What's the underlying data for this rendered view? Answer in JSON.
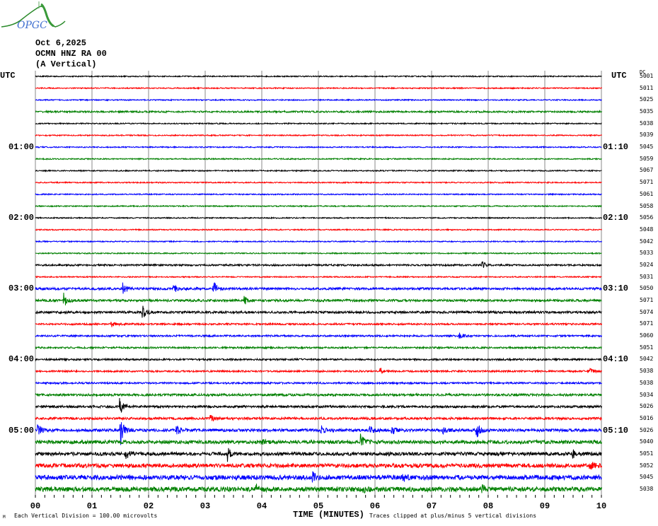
{
  "header": {
    "date": "Oct 6,2025",
    "station": "OCMN HNZ RA 00",
    "component": "(A Vertical)",
    "logo_text": "OPGC"
  },
  "left_axis_label": "UTC",
  "right_axis_label": "UTC",
  "dc_label": "DC",
  "footer": {
    "mark": "M",
    "scale_note": "Each Vertical Division =  100.00 microvolts",
    "xlabel": "TIME (MINUTES)",
    "clip_note": "Traces clipped at plus/minus 5 vertical divisions"
  },
  "chart_data": {
    "type": "line",
    "title": "OCMN HNZ RA 00 helicorder, Oct 6,2025",
    "xlabel": "TIME (MINUTES)",
    "ylabel": "UTC",
    "xlim": [
      0,
      10
    ],
    "x_ticks": [
      "00",
      "01",
      "02",
      "03",
      "04",
      "05",
      "06",
      "07",
      "08",
      "09",
      "10"
    ],
    "grid": true,
    "colors": [
      "#000000",
      "#ff0000",
      "#0000ff",
      "#008000"
    ],
    "minutes_per_row": 10,
    "left_time_labels": [
      {
        "row": 6,
        "text": "01:00"
      },
      {
        "row": 12,
        "text": "02:00"
      },
      {
        "row": 18,
        "text": "03:00"
      },
      {
        "row": 24,
        "text": "04:00"
      },
      {
        "row": 30,
        "text": "05:00"
      }
    ],
    "right_time_labels": [
      {
        "row": 6,
        "text": "01:10"
      },
      {
        "row": 12,
        "text": "02:10"
      },
      {
        "row": 18,
        "text": "03:10"
      },
      {
        "row": 24,
        "text": "04:10"
      },
      {
        "row": 30,
        "text": "05:10"
      }
    ],
    "dc_values": [
      5001,
      5011,
      5025,
      5035,
      5038,
      5039,
      5045,
      5059,
      5067,
      5071,
      5061,
      5058,
      5056,
      5048,
      5042,
      5033,
      5024,
      5031,
      5050,
      5071,
      5074,
      5071,
      5060,
      5051,
      5042,
      5038,
      5038,
      5034,
      5026,
      5016,
      5026,
      5040,
      5051,
      5052,
      5045,
      5038
    ],
    "noise_level_divisions": [
      0.1,
      0.1,
      0.1,
      0.15,
      0.1,
      0.1,
      0.1,
      0.1,
      0.1,
      0.1,
      0.1,
      0.1,
      0.1,
      0.1,
      0.1,
      0.1,
      0.15,
      0.1,
      0.2,
      0.2,
      0.2,
      0.15,
      0.15,
      0.15,
      0.15,
      0.15,
      0.15,
      0.2,
      0.2,
      0.2,
      0.25,
      0.3,
      0.3,
      0.35,
      0.4,
      0.4
    ],
    "events": [
      {
        "row": 16,
        "minute": 7.9,
        "amp": 0.5
      },
      {
        "row": 18,
        "minute": 1.55,
        "amp": 1.0
      },
      {
        "row": 18,
        "minute": 2.45,
        "amp": 0.6
      },
      {
        "row": 18,
        "minute": 3.15,
        "amp": 1.2
      },
      {
        "row": 19,
        "minute": 0.5,
        "amp": 1.2
      },
      {
        "row": 19,
        "minute": 3.7,
        "amp": 0.6
      },
      {
        "row": 20,
        "minute": 1.9,
        "amp": 1.0
      },
      {
        "row": 21,
        "minute": 1.35,
        "amp": 0.8
      },
      {
        "row": 22,
        "minute": 7.5,
        "amp": 0.5
      },
      {
        "row": 25,
        "minute": 6.1,
        "amp": 0.5
      },
      {
        "row": 25,
        "minute": 9.8,
        "amp": 0.4
      },
      {
        "row": 28,
        "minute": 1.5,
        "amp": 1.8
      },
      {
        "row": 29,
        "minute": 3.1,
        "amp": 0.5
      },
      {
        "row": 30,
        "minute": 0.05,
        "amp": 1.0
      },
      {
        "row": 30,
        "minute": 1.5,
        "amp": 2.4
      },
      {
        "row": 30,
        "minute": 2.5,
        "amp": 0.7
      },
      {
        "row": 30,
        "minute": 5.05,
        "amp": 0.7
      },
      {
        "row": 30,
        "minute": 5.9,
        "amp": 0.8
      },
      {
        "row": 30,
        "minute": 6.3,
        "amp": 0.7
      },
      {
        "row": 30,
        "minute": 7.2,
        "amp": 0.6
      },
      {
        "row": 30,
        "minute": 7.8,
        "amp": 1.2
      },
      {
        "row": 31,
        "minute": 4.0,
        "amp": 0.5
      },
      {
        "row": 31,
        "minute": 5.75,
        "amp": 1.4
      },
      {
        "row": 32,
        "minute": 1.6,
        "amp": 0.7
      },
      {
        "row": 32,
        "minute": 3.4,
        "amp": 1.2
      },
      {
        "row": 32,
        "minute": 9.5,
        "amp": 0.6
      },
      {
        "row": 33,
        "minute": 9.8,
        "amp": 0.6
      },
      {
        "row": 34,
        "minute": 4.9,
        "amp": 0.7
      },
      {
        "row": 34,
        "minute": 6.5,
        "amp": 0.5
      },
      {
        "row": 35,
        "minute": 3.9,
        "amp": 0.7
      },
      {
        "row": 35,
        "minute": 5.8,
        "amp": 0.6
      },
      {
        "row": 35,
        "minute": 7.9,
        "amp": 0.6
      }
    ]
  }
}
